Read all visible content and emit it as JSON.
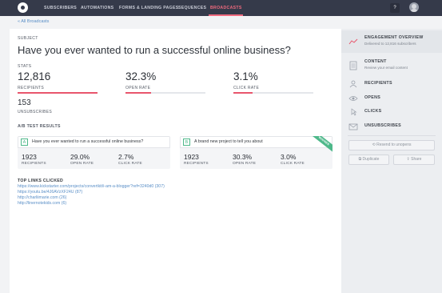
{
  "nav": {
    "items": [
      "SUBSCRIBERS",
      "AUTOMATIONS",
      "FORMS & LANDING PAGES",
      "SEQUENCES",
      "BROADCASTS"
    ],
    "active": "BROADCASTS",
    "help_label": "?"
  },
  "breadcrumb": "« All Broadcasts",
  "subject": {
    "label": "SUBJECT",
    "title": "Have you ever wanted to run a successful online business?"
  },
  "stats": {
    "label": "STATS",
    "recipients": {
      "value": "12,816",
      "label": "RECIPIENTS",
      "fill": 1.0
    },
    "open_rate": {
      "value": "32.3%",
      "label": "OPEN RATE",
      "fill": 0.323
    },
    "click_rate": {
      "value": "3.1%",
      "label": "CLICK RATE",
      "fill": 0.24
    },
    "unsubscribes": {
      "value": "153",
      "label": "UNSUBSCRIBES"
    }
  },
  "ab": {
    "label": "A/B TEST RESULTS",
    "a": {
      "letter": "A",
      "subject": "Have you ever wanted to run a successful online business?",
      "recipients": "1923",
      "recipients_label": "RECIPIENTS",
      "open_rate": "29.0%",
      "open_rate_label": "OPEN RATE",
      "click_rate": "2.7%",
      "click_rate_label": "CLICK RATE"
    },
    "b": {
      "letter": "B",
      "subject": "A brand new project to tell you about",
      "recipients": "1923",
      "recipients_label": "RECIPIENTS",
      "open_rate": "30.3%",
      "open_rate_label": "OPEN RATE",
      "click_rate": "3.0%",
      "click_rate_label": "CLICK RATE",
      "badge": "WINNER"
    }
  },
  "links": {
    "title": "TOP LINKS CLICKED",
    "items": [
      "https://www.kickstarter.com/projects/convertkit/i-am-a-blogger?ref=3240d0 (307)",
      "https://youtu.be/4J6AVzXF24U (87)",
      "http://charliimarie.com (26)",
      "http://linernotekids.com (6)"
    ]
  },
  "sidebar": {
    "engagement": {
      "title": "ENGAGEMENT OVERVIEW",
      "sub": "Delivered to 12,816 subscribers"
    },
    "content": {
      "title": "CONTENT",
      "sub": "Review your email content"
    },
    "recipients": "RECIPIENTS",
    "opens": "OPENS",
    "clicks": "CLICKS",
    "unsubscribes": "UNSUBSCRIBES",
    "resend": "Resend to unopens",
    "duplicate": "Duplicate",
    "share": "Share"
  },
  "colors": {
    "nav_bg": "#353a4a",
    "accent": "#f06a7e",
    "bar": "#e8566c",
    "winner": "#4eb88a",
    "link": "#5a8fc7"
  }
}
